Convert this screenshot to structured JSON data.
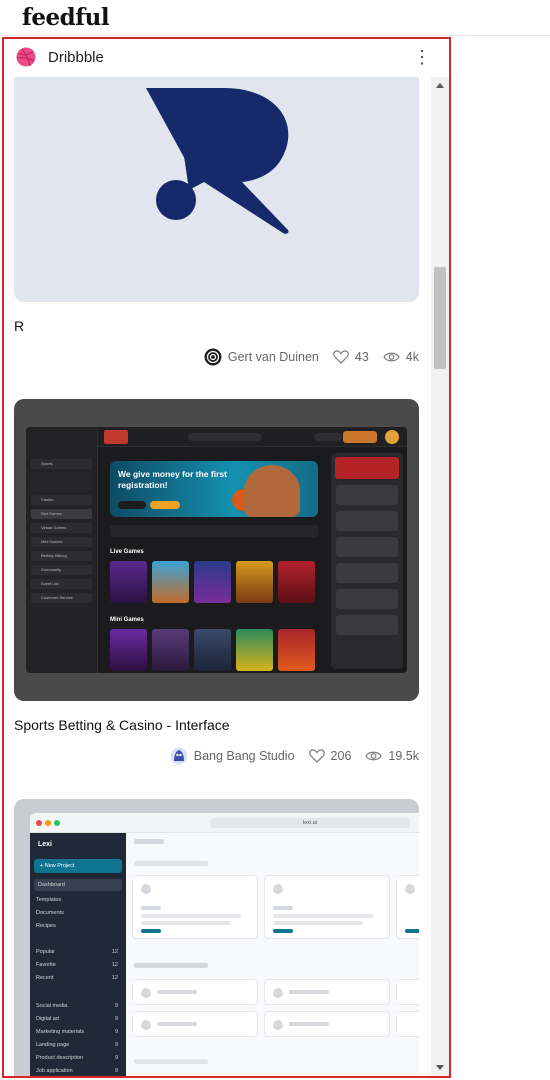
{
  "app": {
    "logo": "feedful"
  },
  "widget": {
    "source": "Dribbble",
    "menu": "⋮"
  },
  "posts": [
    {
      "title": "R",
      "author": "Gert van Duinen",
      "likes": "43",
      "views": "4k"
    },
    {
      "title": "Sports Betting & Casino - Interface",
      "author": "Bang Bang Studio",
      "likes": "206",
      "views": "19.5k"
    },
    {
      "title": "",
      "author": "",
      "likes": "",
      "views": ""
    }
  ],
  "casino_shot": {
    "banner": "We give money for the first registration!",
    "live_games": "Live Games",
    "mini_games": "Mini Games",
    "nav": [
      "Sports",
      "Casino",
      "Slot Games",
      "Virtual Games",
      "Mini Games",
      "Betting History",
      "Community",
      "Event List",
      "Customer Service"
    ]
  },
  "lexi_shot": {
    "brand": "Lexi",
    "url": "lexi.ai",
    "new_project": "+ New Project",
    "nav": [
      "Dashboard",
      "Templates",
      "Documents",
      "Recipes"
    ],
    "groups": [
      {
        "label": "Popular",
        "count": "12"
      },
      {
        "label": "Favorite",
        "count": "12"
      },
      {
        "label": "Recent",
        "count": "12"
      }
    ],
    "folders": [
      {
        "label": "Social media",
        "count": "9"
      },
      {
        "label": "Digital ad",
        "count": "9"
      },
      {
        "label": "Marketing materials",
        "count": "9"
      },
      {
        "label": "Landing page",
        "count": "9"
      },
      {
        "label": "Product description",
        "count": "9"
      },
      {
        "label": "Job application",
        "count": "9"
      }
    ]
  },
  "colors": {
    "frame": "#d8262d",
    "dribbble": "#ea4c89",
    "r_logo": "#16296b"
  }
}
